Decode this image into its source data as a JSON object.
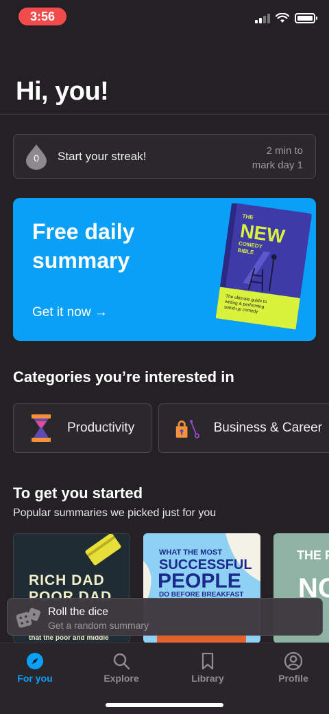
{
  "status_bar": {
    "time": "3:56"
  },
  "greeting": "Hi, you!",
  "streak": {
    "count": "0",
    "label": "Start your streak!",
    "hint_line1": "2 min to",
    "hint_line2": "mark day 1"
  },
  "promo": {
    "title": "Free daily summary",
    "cta": "Get it now →",
    "book": {
      "line1": "THE",
      "line2": "NEW",
      "line3": "COMEDY",
      "line4": "BIBLE",
      "tagline1": "The ultimate guide to",
      "tagline2": "writing & performing",
      "tagline3": "stand-up comedy"
    }
  },
  "categories": {
    "title": "Categories you’re interested in",
    "items": [
      {
        "label": "Productivity",
        "icon": "hourglass-icon"
      },
      {
        "label": "Business & Career",
        "icon": "lock-key-icon"
      }
    ]
  },
  "started": {
    "title": "To get you started",
    "subtitle": "Popular summaries we picked just for you",
    "books": [
      {
        "line1": "RICH DAD",
        "line2": "POOR DAD",
        "footer": "that the poor and middle"
      },
      {
        "line1": "WHAT THE MOST",
        "line2": "SUCCESSFUL",
        "line3": "PEOPLE",
        "line4": "DO BEFORE BREAKFAST"
      },
      {
        "line1": "THE P",
        "line2": "NO"
      }
    ]
  },
  "dice": {
    "title": "Roll the dice",
    "subtitle": "Get a random summary"
  },
  "tabs": [
    {
      "label": "For you",
      "icon": "compass-icon",
      "active": true
    },
    {
      "label": "Explore",
      "icon": "search-icon",
      "active": false
    },
    {
      "label": "Library",
      "icon": "bookmark-icon",
      "active": false
    },
    {
      "label": "Profile",
      "icon": "person-icon",
      "active": false
    }
  ],
  "colors": {
    "background": "#242125",
    "accent": "#0aa0f7",
    "time_pill": "#f24b4b"
  }
}
